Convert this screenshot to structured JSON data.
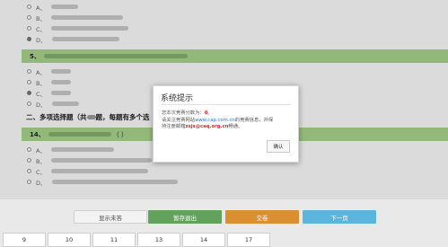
{
  "quiz": {
    "q4_options": [
      {
        "label": "A、",
        "selected": false
      },
      {
        "label": "B、",
        "selected": false
      },
      {
        "label": "C、",
        "selected": false
      },
      {
        "label": "D、",
        "selected": true
      }
    ],
    "q5": {
      "number": "5、"
    },
    "q5_options": [
      {
        "label": "A、",
        "selected": false
      },
      {
        "label": "B、",
        "selected": false
      },
      {
        "label": "C、",
        "selected": true
      },
      {
        "label": "D、",
        "selected": false
      }
    ],
    "section2": {
      "title": "二、多项选择题（共",
      "title_mid": "题，每题有多个选"
    },
    "q14": {
      "number": "14、",
      "suffix": "（  ）"
    },
    "q14_options": [
      {
        "label": "A、",
        "selected": false
      },
      {
        "label": "B、",
        "selected": false
      },
      {
        "label": "C、",
        "selected": false
      },
      {
        "label": "D、",
        "selected": false
      }
    ]
  },
  "modal": {
    "title": "系统提示",
    "line1_prefix": "您本次竞赛分数为：",
    "score": "0",
    "line1_suffix": "。",
    "line2_prefix": "请关注竞赛网站",
    "site": "www.cap.com.cn",
    "line2_suffix": "的竞赛信息，并保",
    "line3_prefix": "持注册邮箱",
    "email": "zsjs@caq.org.cn",
    "line3_suffix": "畅通。",
    "ok_label": "确认"
  },
  "buttons": {
    "show_unanswered": "显示未答",
    "save_exit": "暂存退出",
    "submit": "交卷",
    "next_page": "下一页"
  },
  "pages": [
    "9",
    "10",
    "11",
    "13",
    "14",
    "17"
  ]
}
